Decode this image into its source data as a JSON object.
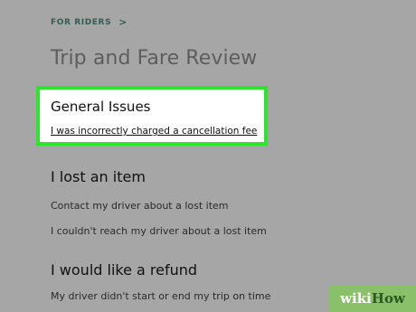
{
  "breadcrumb": {
    "label": "FOR RIDERS",
    "chevron": ">"
  },
  "page_title": "Trip and Fare Review",
  "general_issues": {
    "heading": "General Issues",
    "link": "I was incorrectly charged a cancellation fee"
  },
  "lost_item": {
    "heading": "I lost an item",
    "links": [
      "Contact my driver about a lost item",
      "I couldn't reach my driver about a lost item"
    ]
  },
  "refund": {
    "heading": "I would like a refund",
    "links": [
      "My driver didn't start or end my trip on time"
    ]
  },
  "watermark": {
    "part1": "wiki",
    "part2": "How"
  },
  "colors": {
    "background": "#a6a6a6",
    "highlight_border": "#2ee52e",
    "breadcrumb": "#2f5f57"
  }
}
